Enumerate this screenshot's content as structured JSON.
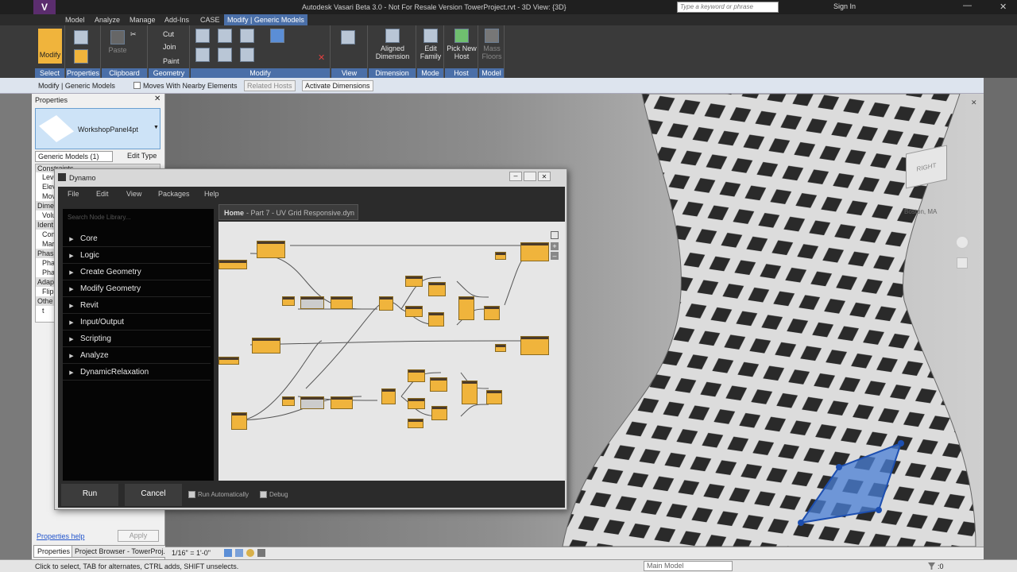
{
  "window": {
    "title": "Autodesk Vasari Beta 3.0 - Not For Resale Version    TowerProject.rvt - 3D View: {3D}",
    "search_placeholder": "Type a keyword or phrase",
    "sign_in": "Sign In"
  },
  "ribbon_tabs": [
    "Model",
    "Analyze",
    "Manage",
    "Add-Ins",
    "CASE",
    "Modify | Generic Models"
  ],
  "ribbon": {
    "modify": "Modify",
    "paste": "Paste",
    "cut": "Cut",
    "join": "Join",
    "paint": "Paint",
    "aligned_dimension": "Aligned Dimension",
    "edit_family": "Edit Family",
    "pick_new_host": "Pick New Host",
    "mass_floors": "Mass Floors",
    "panels": [
      "Select",
      "Properties",
      "Clipboard",
      "Geometry",
      "Modify",
      "View",
      "Dimension",
      "Mode",
      "Host",
      "Model"
    ]
  },
  "context_bar": {
    "label": "Modify | Generic Models",
    "moves_with": "Moves With Nearby Elements",
    "related_hosts": "Related Hosts",
    "activate_dimensions": "Activate Dimensions"
  },
  "properties": {
    "title": "Properties",
    "family": "WorkshopPanel4pt",
    "selector": "Generic Models (1)",
    "edit_type": "Edit Type",
    "rows": [
      "Constraints",
      "Leve",
      "Elev",
      "Mov",
      "Dime",
      "Volu",
      "Ident",
      "Com",
      "Mar",
      "Phas",
      "Phas",
      "Phas",
      "Adap",
      "Flip",
      "Othe",
      "t"
    ],
    "help": "Properties help",
    "apply": "Apply",
    "tab_properties": "Properties",
    "tab_browser": "Project Browser - TowerProj..."
  },
  "dynamo": {
    "title": "Dynamo",
    "menu": [
      "File",
      "Edit",
      "View",
      "Packages",
      "Help"
    ],
    "search_placeholder": "Search Node Library...",
    "library": [
      "Core",
      "Logic",
      "Create Geometry",
      "Modify Geometry",
      "Revit",
      "Input/Output",
      "Scripting",
      "Analyze",
      "DynamicRelaxation"
    ],
    "tab_home": "Home",
    "tab_file": "- Part 7 - UV Grid Responsive.dyn",
    "run": "Run",
    "cancel": "Cancel",
    "run_auto": "Run Automatically",
    "debug": "Debug"
  },
  "viewport": {
    "viewcube_face": "RIGHT",
    "location": "Boston, MA"
  },
  "view_control": {
    "scale": "1/16\" = 1'-0\""
  },
  "status": {
    "message": "Click to select, TAB for alternates, CTRL adds, SHIFT unselects.",
    "main_model": "Main Model",
    "filter_count": ":0"
  }
}
